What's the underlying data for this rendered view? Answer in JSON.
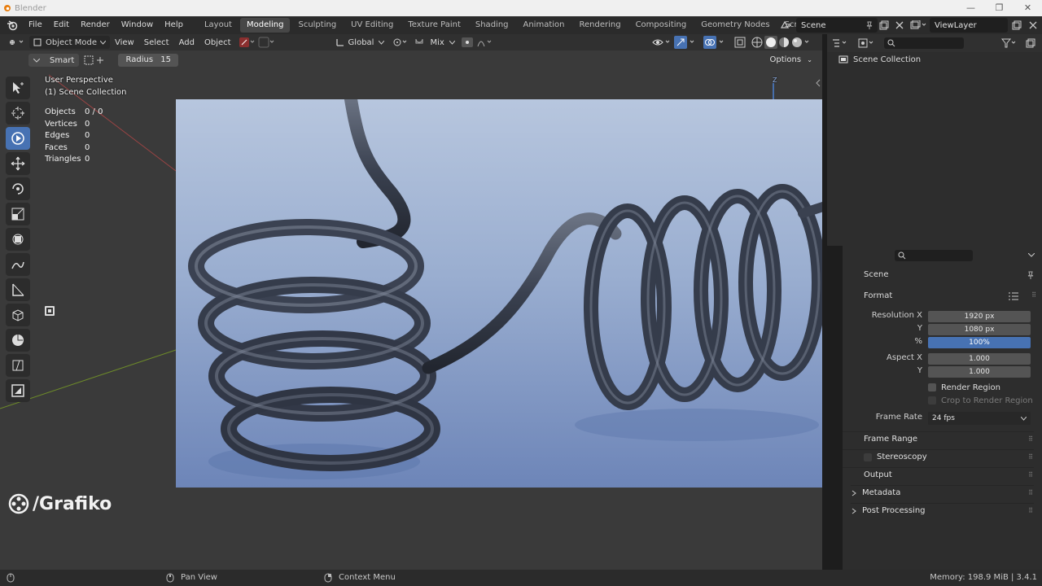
{
  "window": {
    "title": "Blender",
    "controls": [
      "—",
      "❐",
      "✕"
    ]
  },
  "menu": [
    "File",
    "Edit",
    "Render",
    "Window",
    "Help"
  ],
  "workspaces": [
    "Layout",
    "Modeling",
    "Sculpting",
    "UV Editing",
    "Texture Paint",
    "Shading",
    "Animation",
    "Rendering",
    "Compositing",
    "Geometry Nodes",
    "Scripting"
  ],
  "active_workspace": "Modeling",
  "scene": {
    "name": "Scene",
    "view_layer": "ViewLayer"
  },
  "viewport_header": {
    "mode": "Object Mode",
    "menus": [
      "View",
      "Select",
      "Add",
      "Object"
    ],
    "transform_orientation": "Global",
    "snap_mode": "Mix"
  },
  "tool_header": {
    "smart_label": "Smart",
    "radius_label": "Radius",
    "radius_value": "15",
    "options_label": "Options"
  },
  "overlay": {
    "perspective": "User Perspective",
    "collection": "(1) Scene Collection",
    "axis_label": "Z",
    "stats": [
      {
        "label": "Objects",
        "value": "0 / 0"
      },
      {
        "label": "Vertices",
        "value": "0"
      },
      {
        "label": "Edges",
        "value": "0"
      },
      {
        "label": "Faces",
        "value": "0"
      },
      {
        "label": "Triangles",
        "value": "0"
      }
    ]
  },
  "watermark": "/Grafiko",
  "outliner": {
    "root": "Scene Collection"
  },
  "properties": {
    "scene_label": "Scene",
    "format_label": "Format",
    "resolution_x_label": "Resolution X",
    "resolution_x": "1920 px",
    "resolution_y_label": "Y",
    "resolution_y": "1080 px",
    "percent_label": "%",
    "percent": "100%",
    "aspect_x_label": "Aspect X",
    "aspect_x": "1.000",
    "aspect_y_label": "Y",
    "aspect_y": "1.000",
    "render_region": "Render Region",
    "crop_to_render_region": "Crop to Render Region",
    "frame_rate_label": "Frame Rate",
    "frame_rate": "24 fps",
    "panels": [
      "Frame Range",
      "Stereoscopy",
      "Output",
      "Metadata",
      "Post Processing"
    ]
  },
  "statusbar": {
    "pan": "Pan View",
    "context": "Context Menu",
    "memory": "Memory: 198.9 MiB | 3.4.1"
  },
  "colors": {
    "accent_blue": "#4772b3",
    "panel_bg": "#2d2d2d",
    "viewport_bg": "#3a3a3a"
  }
}
